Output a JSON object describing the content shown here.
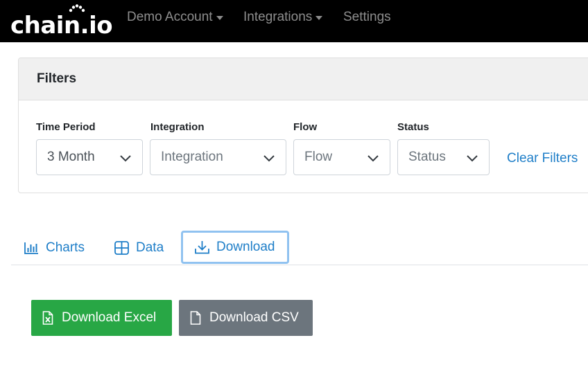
{
  "navbar": {
    "logo_text": "chain.io",
    "items": [
      {
        "label": "Demo Account",
        "has_caret": true
      },
      {
        "label": "Integrations",
        "has_caret": true
      },
      {
        "label": "Settings",
        "has_caret": false
      }
    ]
  },
  "filters": {
    "title": "Filters",
    "fields": [
      {
        "label": "Time Period",
        "value": "3 Month",
        "is_placeholder": false
      },
      {
        "label": "Integration",
        "value": "Integration",
        "is_placeholder": true
      },
      {
        "label": "Flow",
        "value": "Flow",
        "is_placeholder": true
      },
      {
        "label": "Status",
        "value": "Status",
        "is_placeholder": true
      }
    ],
    "clear_label": "Clear Filters"
  },
  "tabs": [
    {
      "label": "Charts",
      "icon": "bar-chart-icon",
      "active": false
    },
    {
      "label": "Data",
      "icon": "grid-icon",
      "active": false
    },
    {
      "label": "Download",
      "icon": "download-icon",
      "active": true
    }
  ],
  "downloads": {
    "excel_label": "Download Excel",
    "csv_label": "Download CSV"
  },
  "colors": {
    "navbar_bg": "#000000",
    "link": "#1e7ec8",
    "excel_button": "#28a745",
    "csv_button": "#6c757d",
    "active_tab_border": "#90c2f0"
  }
}
